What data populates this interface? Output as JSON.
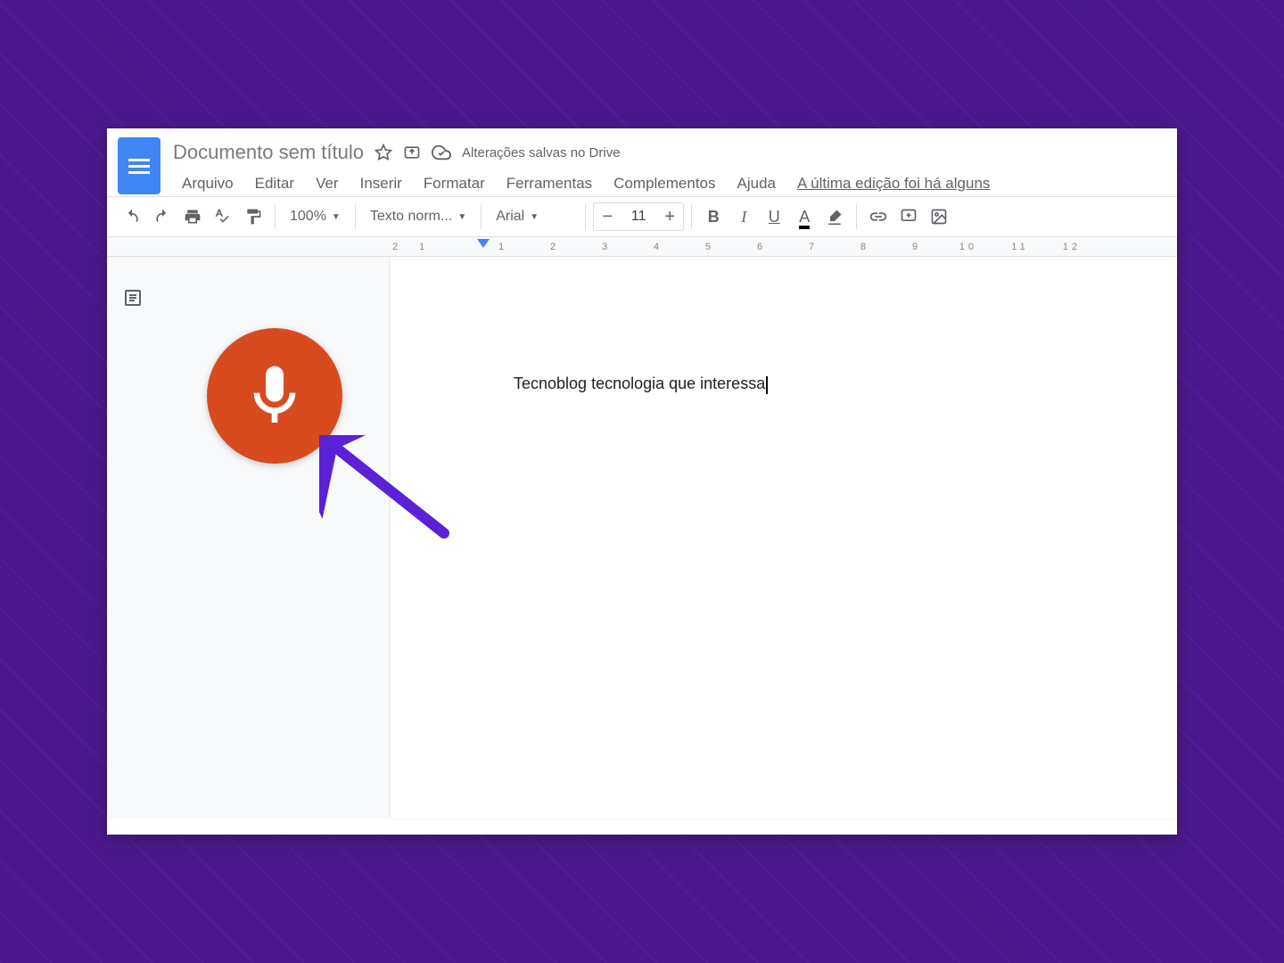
{
  "header": {
    "title": "Documento sem título",
    "save_status": "Alterações salvas no Drive",
    "last_edit": "A última edição foi há alguns"
  },
  "menus": {
    "arquivo": "Arquivo",
    "editar": "Editar",
    "ver": "Ver",
    "inserir": "Inserir",
    "formatar": "Formatar",
    "ferramentas": "Ferramentas",
    "complementos": "Complementos",
    "ajuda": "Ajuda"
  },
  "toolbar": {
    "zoom": "100%",
    "style": "Texto norm...",
    "font": "Arial",
    "size": "11"
  },
  "ruler": {
    "neg2": "2",
    "neg1": "1",
    "ticks": [
      "1",
      "2",
      "3",
      "4",
      "5",
      "6",
      "7",
      "8",
      "9",
      "10",
      "11",
      "12"
    ]
  },
  "document": {
    "text": "Tecnoblog tecnologia que interessa"
  }
}
